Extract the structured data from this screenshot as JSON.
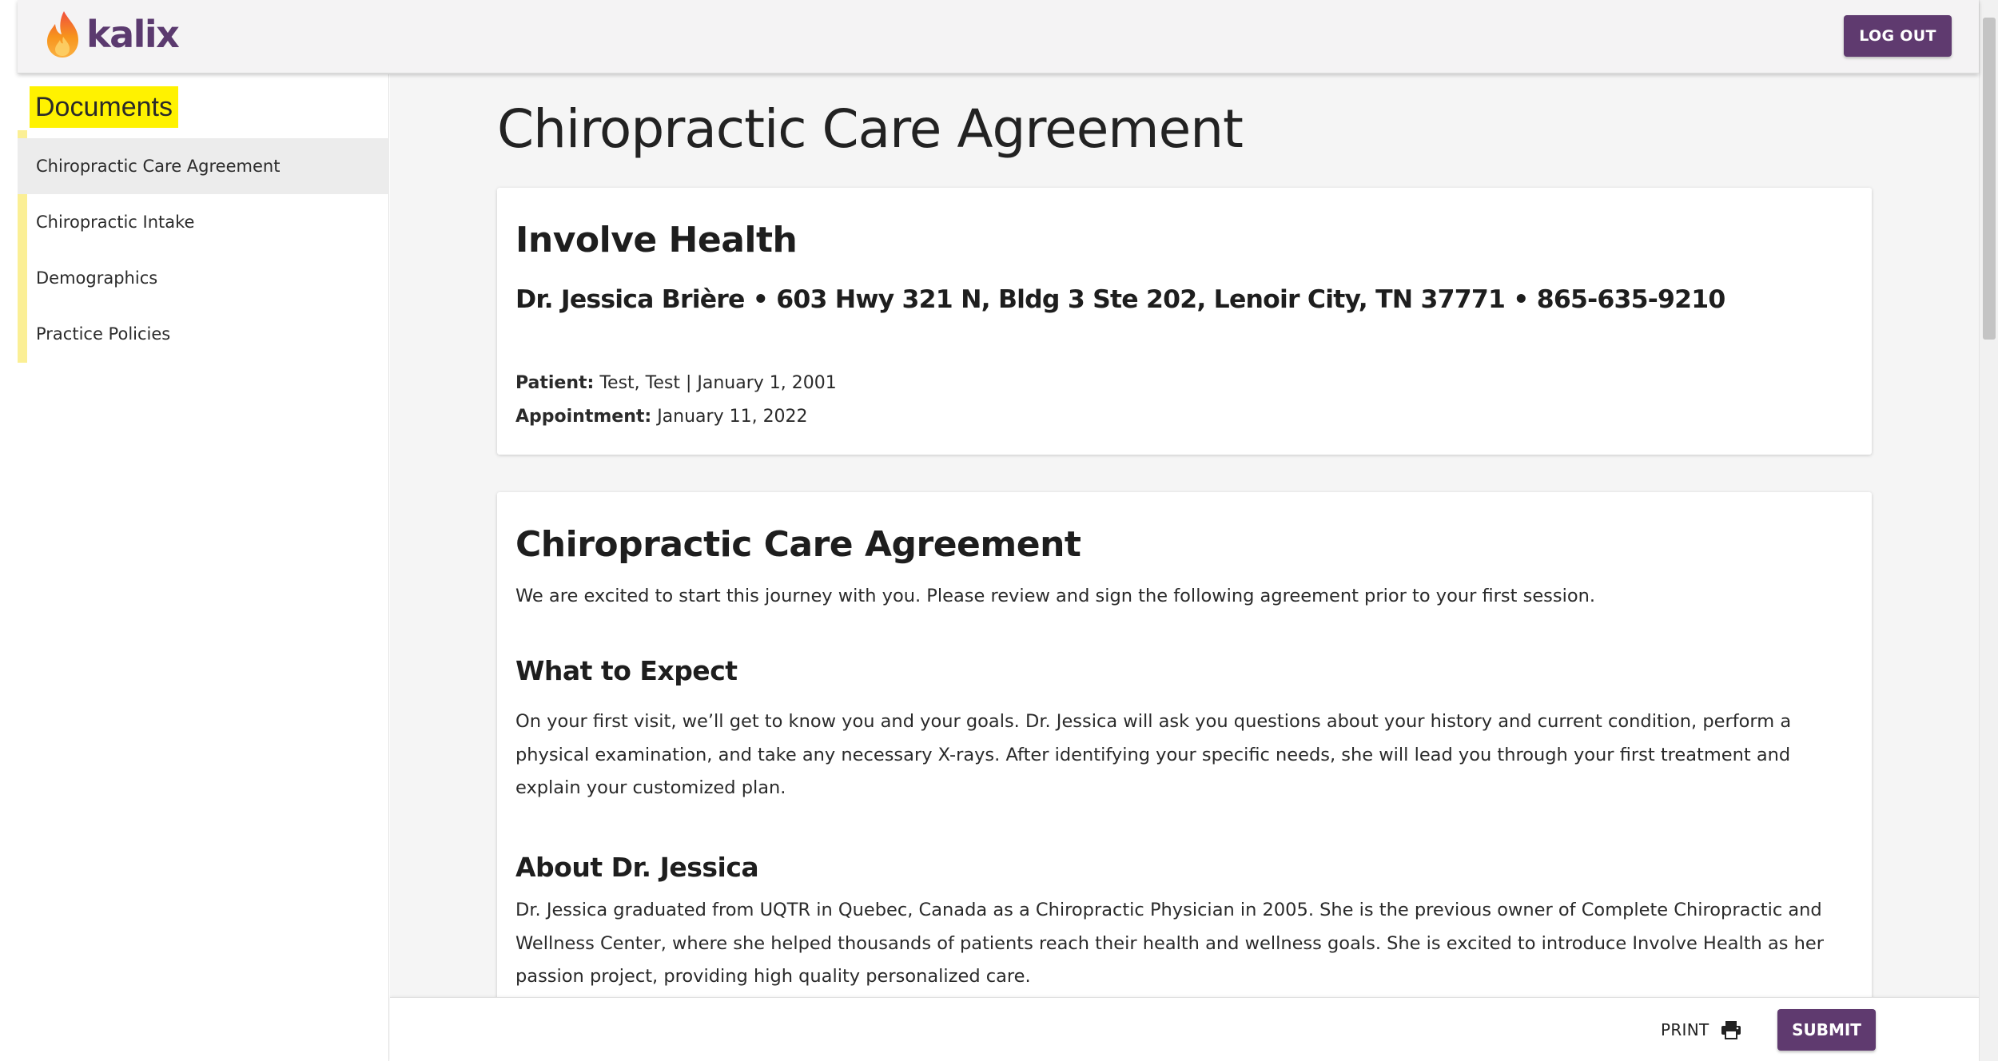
{
  "header": {
    "logo_text": "kalix",
    "logout_label": "LOG OUT"
  },
  "sidebar": {
    "title": "Documents",
    "items": [
      {
        "label": "Chiropractic Care Agreement",
        "active": true
      },
      {
        "label": "Chiropractic Intake",
        "active": false
      },
      {
        "label": "Demographics",
        "active": false
      },
      {
        "label": "Practice Policies",
        "active": false
      }
    ]
  },
  "main": {
    "page_title": "Chiropractic Care Agreement",
    "practice": {
      "name": "Involve Health",
      "info": "Dr. Jessica Brière • 603 Hwy 321 N, Bldg 3 Ste 202, Lenoir City, TN 37771 • 865-635-9210",
      "patient_label": "Patient:",
      "patient_value": "Test, Test | January 1, 2001",
      "appointment_label": "Appointment:",
      "appointment_value": "January 11, 2022"
    },
    "agreement": {
      "title": "Chiropractic Care Agreement",
      "intro": "We are excited to start this journey with you. Please review and sign the following agreement prior to your first session.",
      "sections": [
        {
          "heading": "What to Expect",
          "text": "On your first visit, we’ll get to know you and your goals. Dr. Jessica will ask you questions about your history and current condition, perform a physical examination, and take any necessary X-rays. After identifying your specific needs, she will lead you through your first treatment and explain your customized plan."
        },
        {
          "heading": "About Dr. Jessica",
          "text": "Dr. Jessica graduated from UQTR in Quebec, Canada as a Chiropractic Physician in 2005. She is the previous owner of Complete Chiropractic and Wellness Center, where she helped thousands of patients reach their health and wellness goals. She is excited to introduce Involve Health as her passion project, providing high quality personalized care."
        }
      ]
    }
  },
  "footer": {
    "print_label": "PRINT",
    "submit_label": "SUBMIT"
  },
  "colors": {
    "brand_purple": "#5f3a6f",
    "highlight_yellow": "#fff200",
    "flame_orange": "#f58220"
  }
}
